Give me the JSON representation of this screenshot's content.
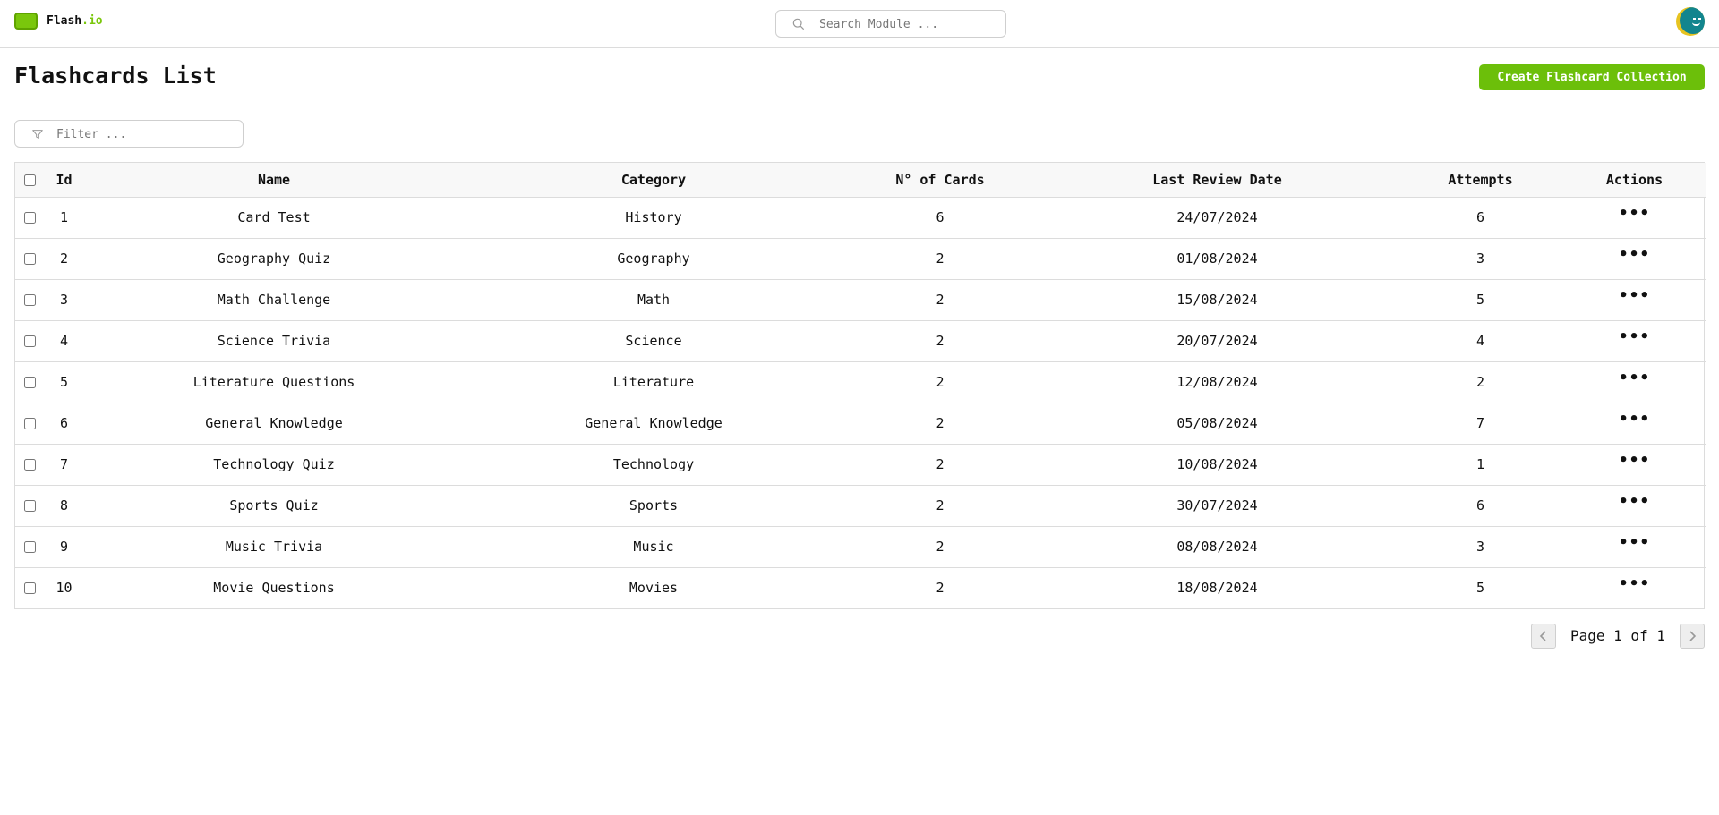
{
  "app": {
    "brand_name": "Flash",
    "brand_tld": ".io",
    "brand_color": "#7ac70c"
  },
  "search": {
    "placeholder": "Search Module ..."
  },
  "page": {
    "title": "Flashcards List",
    "create_label": "Create Flashcard Collection"
  },
  "filter": {
    "placeholder": "Filter ..."
  },
  "table": {
    "headers": {
      "id": "Id",
      "name": "Name",
      "category": "Category",
      "cards": "N° of Cards",
      "last_review": "Last Review Date",
      "attempts": "Attempts",
      "actions": "Actions"
    },
    "action_glyph": "•••",
    "rows": [
      {
        "id": "1",
        "name": "Card Test",
        "category": "History",
        "cards": "6",
        "last_review": "24/07/2024",
        "attempts": "6"
      },
      {
        "id": "2",
        "name": "Geography Quiz",
        "category": "Geography",
        "cards": "2",
        "last_review": "01/08/2024",
        "attempts": "3"
      },
      {
        "id": "3",
        "name": "Math Challenge",
        "category": "Math",
        "cards": "2",
        "last_review": "15/08/2024",
        "attempts": "5"
      },
      {
        "id": "4",
        "name": "Science Trivia",
        "category": "Science",
        "cards": "2",
        "last_review": "20/07/2024",
        "attempts": "4"
      },
      {
        "id": "5",
        "name": "Literature Questions",
        "category": "Literature",
        "cards": "2",
        "last_review": "12/08/2024",
        "attempts": "2"
      },
      {
        "id": "6",
        "name": "General Knowledge",
        "category": "General Knowledge",
        "cards": "2",
        "last_review": "05/08/2024",
        "attempts": "7"
      },
      {
        "id": "7",
        "name": "Technology Quiz",
        "category": "Technology",
        "cards": "2",
        "last_review": "10/08/2024",
        "attempts": "1"
      },
      {
        "id": "8",
        "name": "Sports Quiz",
        "category": "Sports",
        "cards": "2",
        "last_review": "30/07/2024",
        "attempts": "6"
      },
      {
        "id": "9",
        "name": "Music Trivia",
        "category": "Music",
        "cards": "2",
        "last_review": "08/08/2024",
        "attempts": "3"
      },
      {
        "id": "10",
        "name": "Movie Questions",
        "category": "Movies",
        "cards": "2",
        "last_review": "18/08/2024",
        "attempts": "5"
      }
    ]
  },
  "pagination": {
    "label": "Page 1 of 1"
  }
}
